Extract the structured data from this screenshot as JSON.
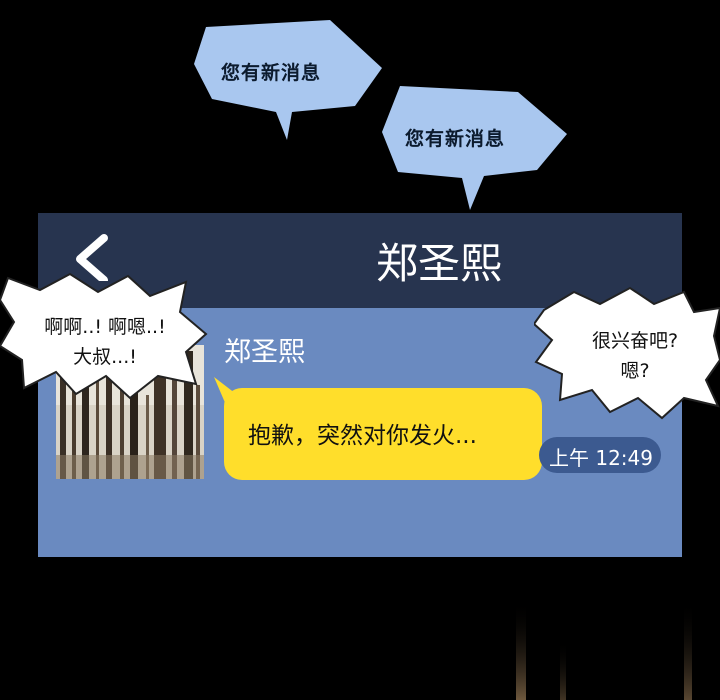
{
  "notifications": [
    {
      "text": "您有新消息"
    },
    {
      "text": "您有新消息"
    }
  ],
  "phone": {
    "contact_name": "郑圣熙",
    "sender_name": "郑圣熙",
    "message": "抱歉，突然对你发火...",
    "timestamp": "上午 12:49",
    "back_icon": "chevron-left-icon"
  },
  "speech_left": {
    "line1": "啊啊..! 啊嗯..!",
    "line2": "大叔...!"
  },
  "speech_right": {
    "line1": "很兴奋吧?",
    "line2": "嗯?"
  },
  "colors": {
    "background": "#000000",
    "header": "#27344f",
    "chat_bg": "#6a8ac0",
    "message_bubble": "#ffde2b",
    "time_pill": "#3c5a90",
    "notification_bubble": "#a9c7ef"
  }
}
